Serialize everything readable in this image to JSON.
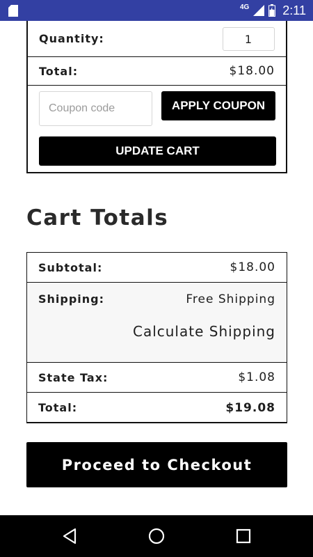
{
  "status_bar": {
    "network": "4G",
    "time": "2:11",
    "bg_color": "#3340a3"
  },
  "cart_item": {
    "quantity_label": "Quantity:",
    "quantity_value": "1",
    "total_label": "Total:",
    "total_value": "$18.00",
    "coupon_placeholder": "Coupon code",
    "apply_coupon_label": "APPLY COUPON",
    "update_cart_label": "UPDATE CART"
  },
  "cart_totals": {
    "title": "Cart Totals",
    "subtotal_label": "Subtotal:",
    "subtotal_value": "$18.00",
    "shipping_label": "Shipping:",
    "shipping_value": "Free Shipping",
    "calculate_shipping_label": "Calculate Shipping",
    "state_tax_label": "State Tax:",
    "state_tax_value": "$1.08",
    "total_label": "Total:",
    "total_value": "$19.08"
  },
  "checkout": {
    "label": "Proceed to Checkout"
  },
  "icons": {
    "sd_card": "sd-card-icon",
    "signal": "signal-icon",
    "battery": "battery-icon",
    "back": "back-icon",
    "home": "home-icon",
    "recents": "recents-icon"
  }
}
